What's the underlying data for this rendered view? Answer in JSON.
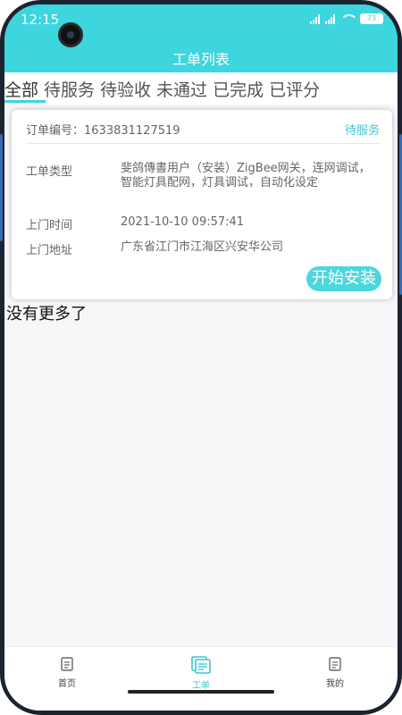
{
  "status_bar": {
    "time": "12:15",
    "battery": "73"
  },
  "header": {
    "title": "工单列表"
  },
  "tabs": [
    {
      "label": "全部",
      "active": true
    },
    {
      "label": "待服务"
    },
    {
      "label": "待验收"
    },
    {
      "label": "未通过"
    },
    {
      "label": "已完成"
    },
    {
      "label": "已评分"
    }
  ],
  "order": {
    "number_label": "订单编号：",
    "number": "1633831127519",
    "status": "待服务",
    "type_label": "工单类型",
    "type_value": "斐鸽傳書用户（安装）ZigBee网关，连网调试，智能灯具配网，灯具调试，自动化设定",
    "time_label": "上门时间",
    "time_value": "2021-10-10 09:57:41",
    "address_label": "上门地址",
    "address_value": "广东省江门市江海区兴安华公司",
    "action_label": "开始安装"
  },
  "list_footer": "没有更多了",
  "bottom_nav": [
    {
      "label": "首页",
      "icon": "home-doc-icon"
    },
    {
      "label": "工单",
      "icon": "work-order-icon",
      "active": true
    },
    {
      "label": "我的",
      "icon": "profile-doc-icon"
    }
  ],
  "colors": {
    "accent": "#3dd5de",
    "accent_text": "#3dc6cf"
  }
}
